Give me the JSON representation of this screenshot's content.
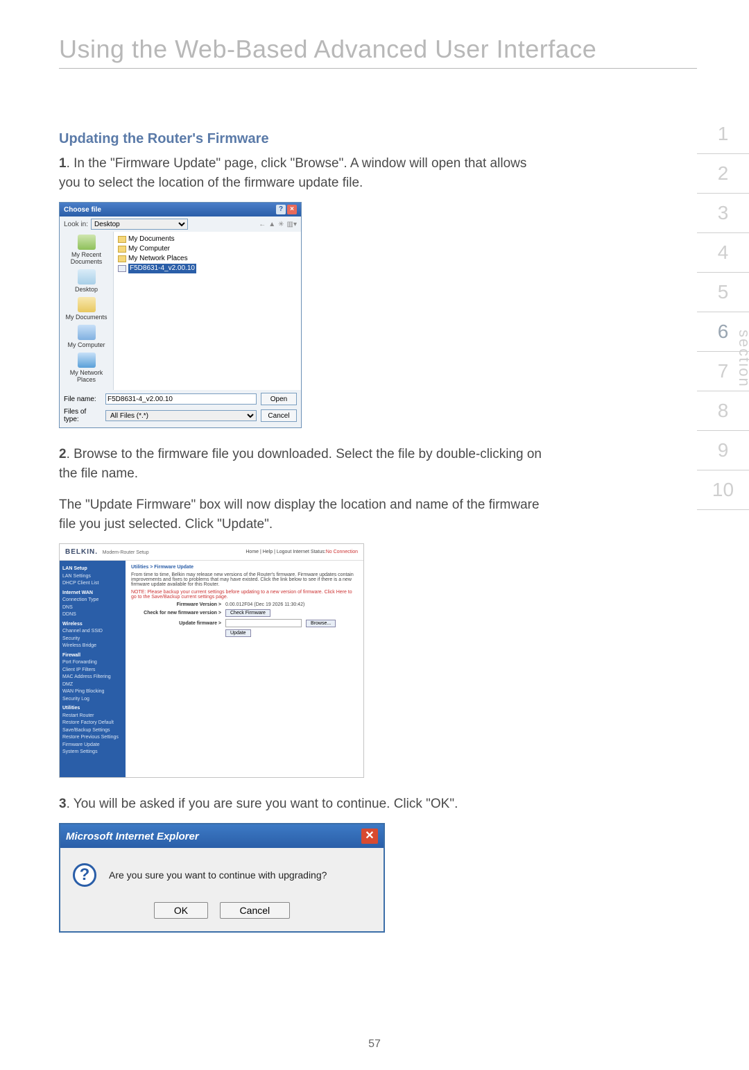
{
  "title": "Using the Web-Based Advanced User Interface",
  "subhead": "Updating the Router's Firmware",
  "step1_num": "1",
  "step1_text": ". In the \"Firmware Update\" page, click \"Browse\". A window will open that allows you to select the location of the firmware update file.",
  "step2_num": "2",
  "step2_text": ". Browse to the firmware file you downloaded. Select the file by double-clicking on the file name.",
  "step2_para": "The \"Update Firmware\" box will now display the location and name of the firmware file you just selected. Click \"Update\".",
  "step3_num": "3",
  "step3_text": ". You will be asked if you are sure you want to continue. Click \"OK\".",
  "page_number": "57",
  "side_label": "section",
  "side_numbers": [
    "1",
    "2",
    "3",
    "4",
    "5",
    "6",
    "7",
    "8",
    "9",
    "10"
  ],
  "side_current_index": 5,
  "choosefile": {
    "title": "Choose file",
    "lookin_label": "Look in:",
    "lookin_value": "Desktop",
    "places": [
      "My Recent Documents",
      "Desktop",
      "My Documents",
      "My Computer",
      "My Network Places"
    ],
    "list_items": [
      "My Documents",
      "My Computer",
      "My Network Places"
    ],
    "selected_file": "F5D8631-4_v2.00.10",
    "filename_label": "File name:",
    "filename_value": "F5D8631-4_v2.00.10",
    "filetype_label": "Files of type:",
    "filetype_value": "All Files (*.*)",
    "open": "Open",
    "cancel": "Cancel"
  },
  "belkin": {
    "logo": "BELKIN.",
    "tagline": "Modem-Router Setup",
    "toplinks_prefix": "Home | Help | Logout    Internet Status:",
    "toplinks_status": "No Connection",
    "crumb": "Utilities > Firmware Update",
    "intro": "From time to time, Belkin may release new versions of the Router's firmware. Firmware updates contain improvements and fixes to problems that may have existed. Click the link below to see if there is a new firmware update available for this Router.",
    "note": "NOTE: Please backup your current settings before updating to a new version of firmware. Click Here to go to the Save/Backup current settings page.",
    "fw_version_label": "Firmware Version >",
    "fw_version_value": "0.00.012F04 (Dec 19 2026 11:30:42)",
    "check_label": "Check for new firmware version >",
    "check_btn": "Check Firmware",
    "update_label": "Update firmware >",
    "browse_btn": "Browse...",
    "update_btn": "Update",
    "nav_sections": [
      {
        "h": "LAN Setup",
        "items": [
          "LAN Settings",
          "DHCP Client List"
        ]
      },
      {
        "h": "Internet WAN",
        "items": [
          "Connection Type",
          "DNS",
          "DDNS"
        ]
      },
      {
        "h": "Wireless",
        "items": [
          "Channel and SSID",
          "Security",
          "Wireless Bridge"
        ]
      },
      {
        "h": "Firewall",
        "items": [
          "Port Forwarding",
          "Client IP Filters",
          "MAC Address Filtering",
          "DMZ",
          "WAN Ping Blocking",
          "Security Log"
        ]
      },
      {
        "h": "Utilities",
        "items": [
          "Restart Router",
          "Restore Factory Default",
          "Save/Backup Settings",
          "Restore Previous Settings",
          "Firmware Update",
          "System Settings"
        ]
      }
    ]
  },
  "iebox": {
    "title": "Microsoft Internet Explorer",
    "message": "Are you sure you want to continue with upgrading?",
    "ok": "OK",
    "cancel": "Cancel"
  }
}
